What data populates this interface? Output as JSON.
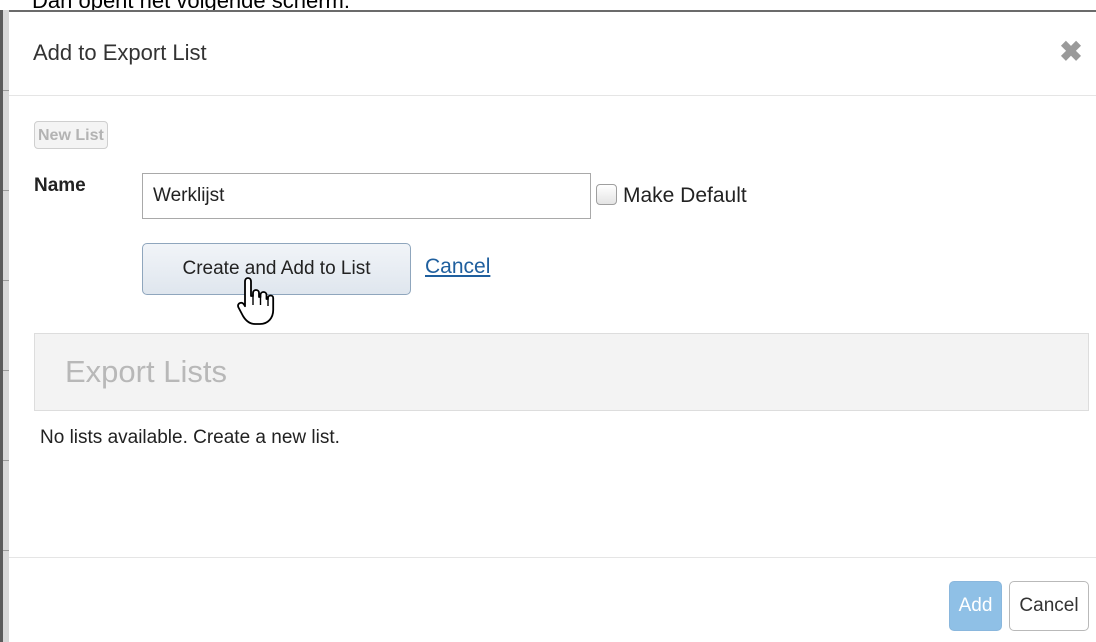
{
  "page": {
    "caption": "Dan opent het volgende scherm:"
  },
  "dialog": {
    "title": "Add to Export List",
    "close_icon": "close-icon"
  },
  "new_list_button": {
    "label": "New List"
  },
  "form": {
    "name_label": "Name",
    "name_value": "Werklijst",
    "make_default_label": "Make Default",
    "make_default_checked": false,
    "create_button_label": "Create and Add to List",
    "cancel_link_label": "Cancel"
  },
  "export_lists": {
    "heading": "Export Lists",
    "empty_message": "No lists available. Create a new list."
  },
  "footer": {
    "add_label": "Add",
    "cancel_label": "Cancel"
  },
  "cursor": {
    "icon": "hand-pointer-icon"
  },
  "colors": {
    "primary_button": "#8fc0e6",
    "link": "#1f5f9e",
    "panel_heading_bg": "#f3f3f3"
  }
}
